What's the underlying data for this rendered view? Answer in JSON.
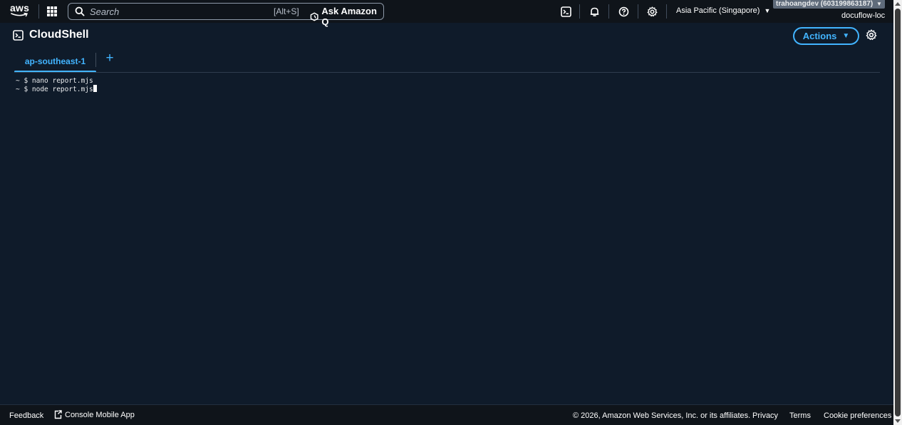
{
  "nav": {
    "logo_text": "aws",
    "search": {
      "placeholder": "Search",
      "value": "",
      "shortcut": "[Alt+S]"
    },
    "ask_amazon_q_label": "Ask Amazon Q",
    "region_label": "Asia Pacific (Singapore)",
    "account_label": "trahoangdev (603199863187)",
    "account_alias": "docuflow-loc",
    "icons": [
      "cloudshell-icon",
      "bell-icon",
      "help-icon",
      "gear-icon"
    ]
  },
  "cloudshell": {
    "title": "CloudShell",
    "actions_label": "Actions"
  },
  "tabs": [
    {
      "label": "ap-southeast-1",
      "active": true
    }
  ],
  "add_tab_label": "+",
  "terminal": {
    "lines": [
      "~ $ nano report.mjs",
      "~ $ node report.mjs"
    ]
  },
  "footer": {
    "feedback": "Feedback",
    "mobile_app": "Console Mobile App",
    "copyright": "© 2026, Amazon Web Services, Inc. or its affiliates.",
    "privacy": "Privacy",
    "terms": "Terms",
    "cookies": "Cookie preferences"
  },
  "colors": {
    "accent": "#42b4ff",
    "nav_background": "#0f141a",
    "content_background": "#0f1b2a"
  }
}
